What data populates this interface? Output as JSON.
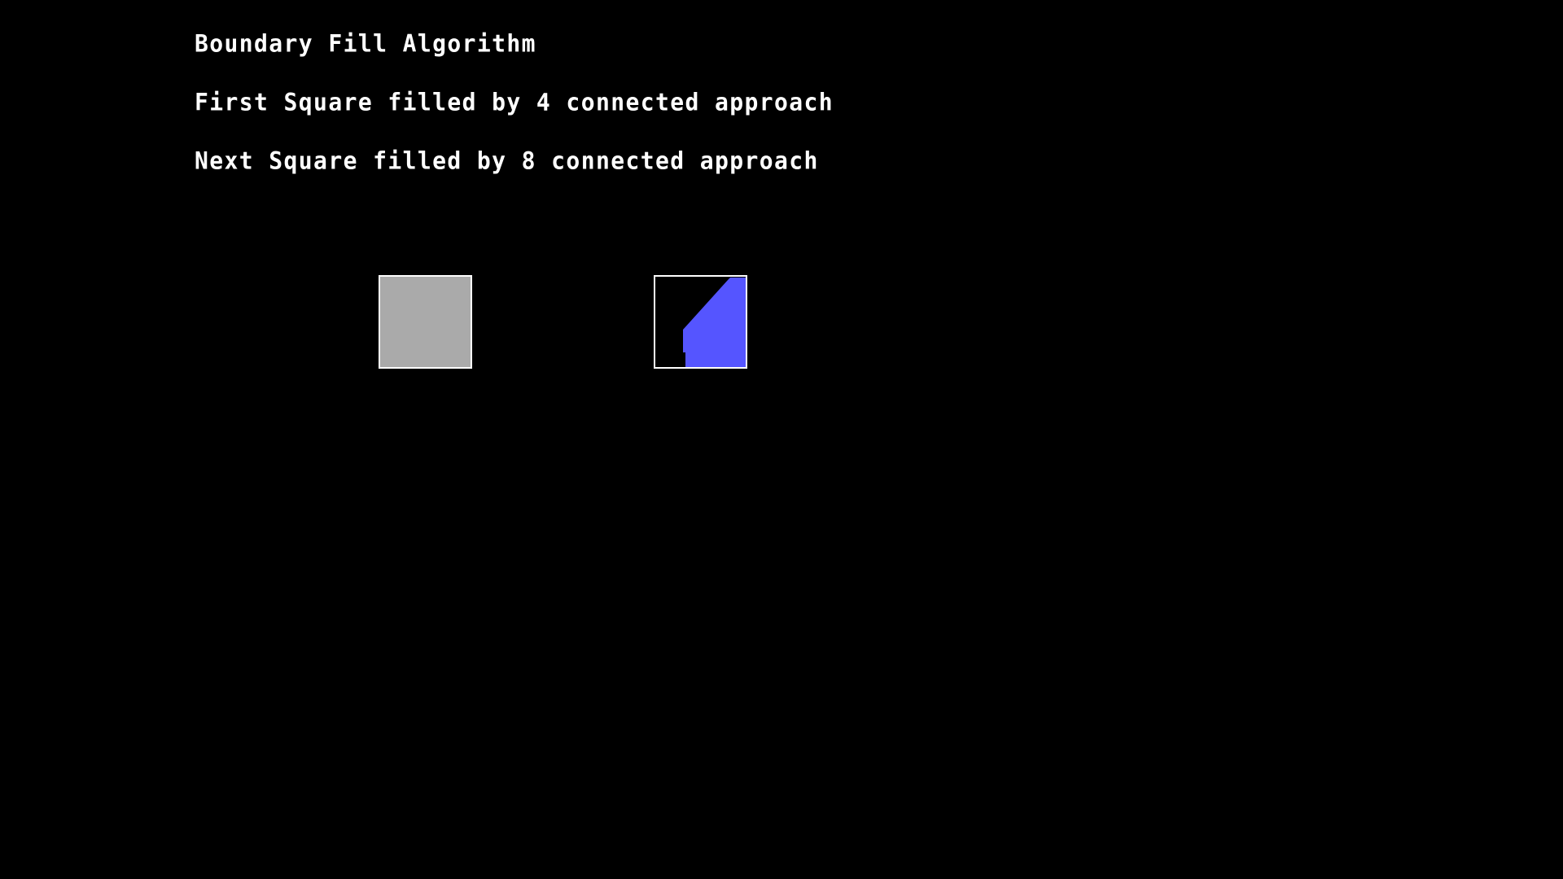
{
  "window": {
    "background": "#000000"
  },
  "text_lines": {
    "title": "Boundary Fill Algorithm",
    "first": "First Square filled by 4 connected approach",
    "next": "Next Square filled by 8 connected approach"
  },
  "colors": {
    "text": "#ffffff",
    "boundary": "#ffffff",
    "fill_4_connected": "#aaaaaa",
    "fill_8_connected": "#5555ff"
  }
}
